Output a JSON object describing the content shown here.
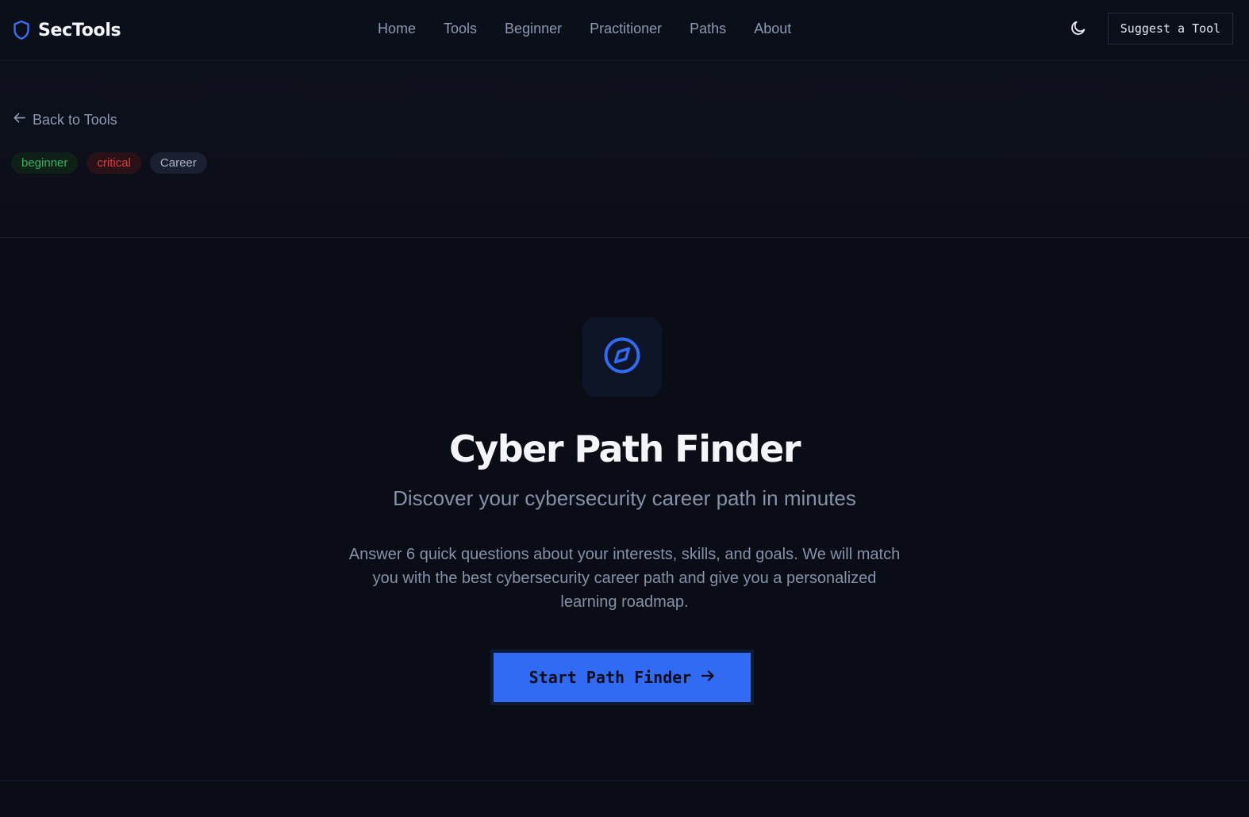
{
  "brand": {
    "name": "SecTools",
    "icon": "shield-icon",
    "accent": "#3b6cf2"
  },
  "nav": {
    "items": [
      {
        "label": "Home"
      },
      {
        "label": "Tools"
      },
      {
        "label": "Beginner"
      },
      {
        "label": "Practitioner"
      },
      {
        "label": "Paths"
      },
      {
        "label": "About"
      }
    ],
    "theme_icon": "moon-icon",
    "suggest_label": "Suggest a Tool"
  },
  "header": {
    "back_label": "Back to Tools",
    "tags": [
      {
        "label": "beginner",
        "color": "#2fb45f"
      },
      {
        "label": "critical",
        "color": "#e03a3a"
      },
      {
        "label": "Career",
        "color": "#a9b2c4"
      }
    ]
  },
  "main": {
    "icon": "compass-icon",
    "title": "Cyber Path Finder",
    "subtitle": "Discover your cybersecurity career path in minutes",
    "description": "Answer 6 quick questions about your interests, skills, and goals. We will match you with the best cybersecurity career path and give you a personalized learning roadmap.",
    "cta_label": "Start Path Finder",
    "cta_color": "#316bf3"
  }
}
